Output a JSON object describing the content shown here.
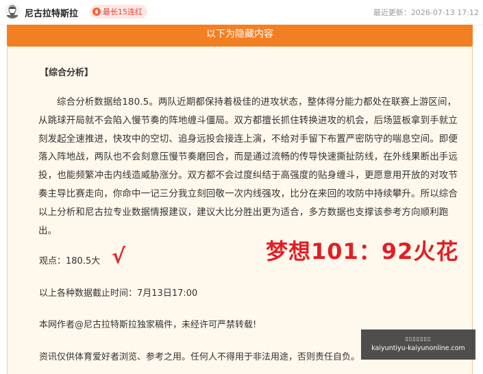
{
  "header": {
    "author": "尼古拉特斯拉",
    "badge": "最长15连红",
    "updated": "最近更新：2026-07-13 17:12"
  },
  "hidden_banner": "以下为隐藏内容",
  "section_title": "【综合分析】",
  "analysis": "综合分析数据给180.5。两队近期都保持着极佳的进攻状态，整体得分能力都处在联赛上游区间，从跳球开局就不会陷入慢节奏的阵地缠斗僵局。双方都擅长抓住转换进攻的机会，后场篮板拿到手就立刻发起全速推进，快攻中的空切、追身远投会接连上演，不给对手留下布置严密防守的喘息空间。即便落入阵地战，两队也不会刻意压慢节奏磨回合，而是通过流畅的传导快速撕扯防线，在外线果断出手远投，也能频繁冲击内线造威胁涨分。双方都不会过度纠结于高强度的贴身缠斗，更愿意用开放的对攻节奏主导比赛走向，你命中一记三分我立刻回敬一次内线强攻，比分在来回的攻防中持续攀升。所以综合以上分析和尼古拉专业数据情报建议，建议大比分胜出更为适合，多方数据也支撑该参考方向顺利跑出。",
  "view": "观点：180.5大",
  "check_mark": "√",
  "dream_text": "梦想101：92火花",
  "deadline": "以上各种数据截止时间：7月13日17:00",
  "copyright": "本网作者@尼古拉特斯拉独家稿件，未经许可严禁转载!",
  "disclaimer": "资讯仅供体育爱好者浏览、参考之用。任何人不得用于非法用途，否则责任自负。",
  "watermark": {
    "top": "▯▯▯▯▯▯▯",
    "url": "kaiyuntiyu-kaiyunonline.com"
  },
  "icons": {
    "avatar": "author-portrait",
    "badge": "fire-icon"
  }
}
